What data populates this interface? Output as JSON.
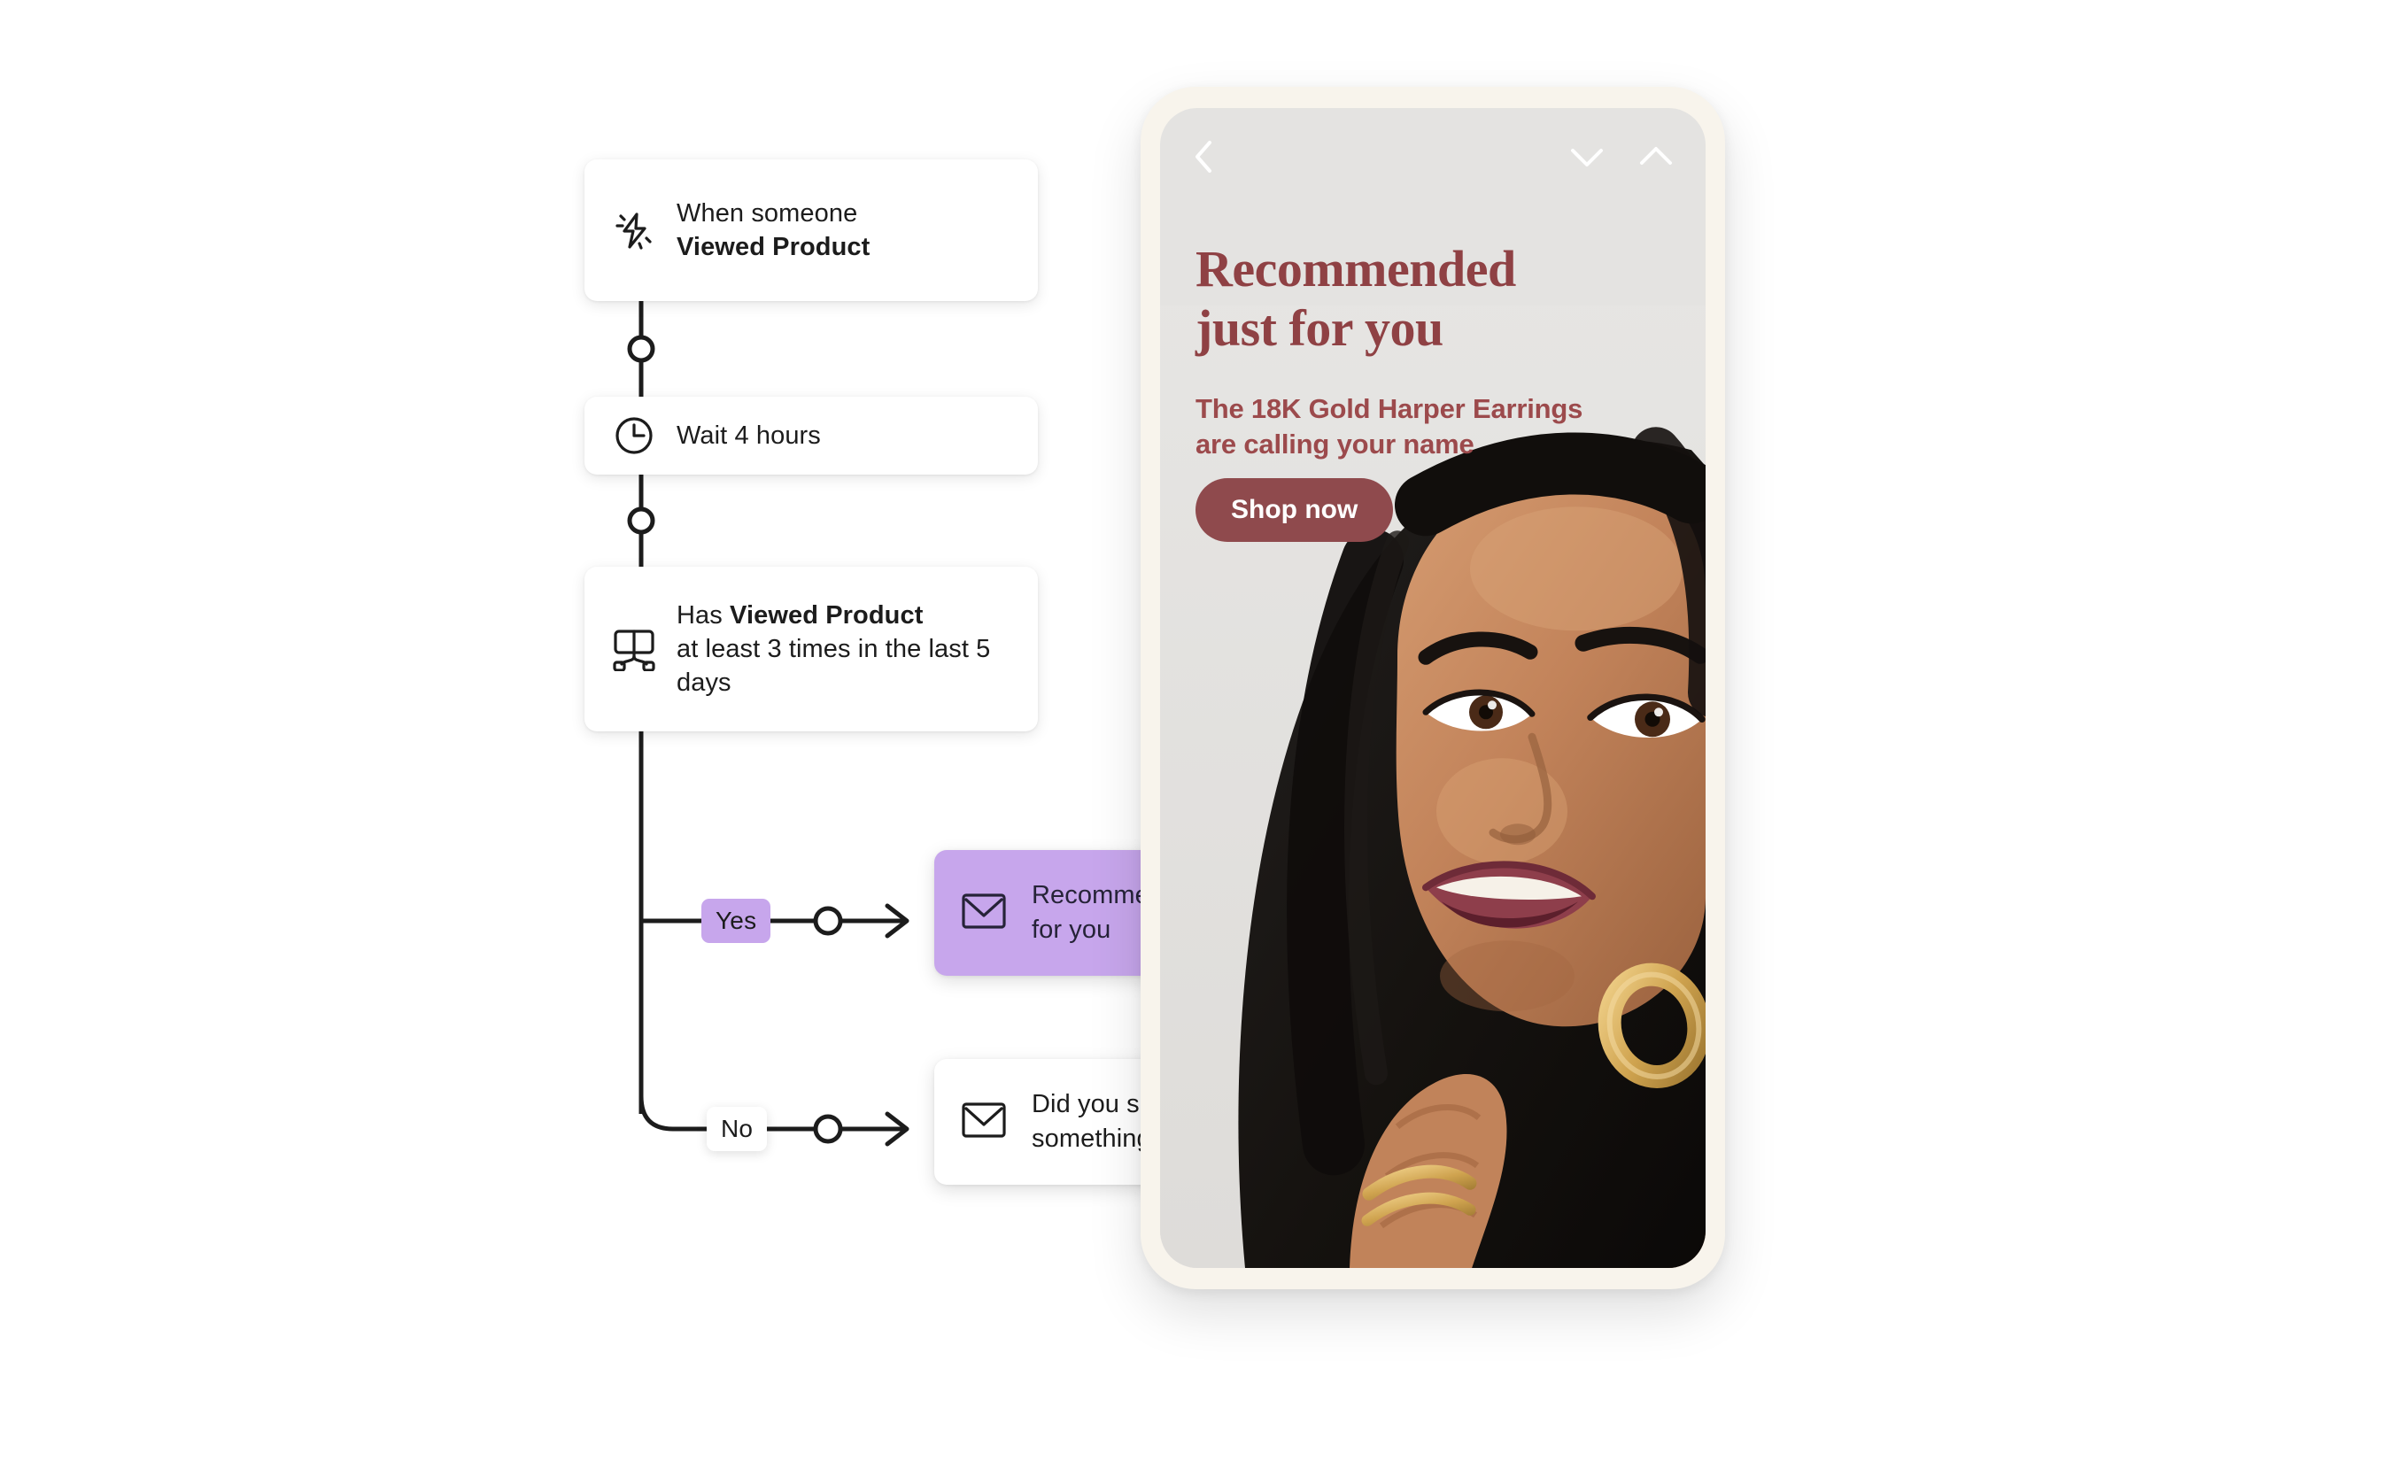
{
  "flow": {
    "nodes": [
      {
        "id": "trigger",
        "icon": "lightning-bolt-icon",
        "line1": "When someone",
        "line2": "Viewed Product"
      },
      {
        "id": "wait",
        "icon": "clock-icon",
        "label": "Wait 4 hours"
      },
      {
        "id": "condition",
        "icon": "split-branch-icon",
        "prefix": "Has ",
        "strong": "Viewed Product",
        "rest": "at least 3 times in the last 5 days"
      }
    ],
    "branches": [
      {
        "id": "yes",
        "label": "Yes",
        "color": "#c7a6ec"
      },
      {
        "id": "no",
        "label": "No",
        "color": "#ffffff"
      }
    ],
    "messages": [
      {
        "id": "yes-message",
        "icon": "envelope-icon",
        "line1": "Recommended just",
        "line2": "for you",
        "color": "#c7a6ec"
      },
      {
        "id": "no-message",
        "icon": "envelope-icon",
        "line1": "Did you see",
        "line2": "something you liked?",
        "color": "#ffffff"
      }
    ]
  },
  "phone": {
    "nav": {
      "back_icon": "chevron-left-icon",
      "down_icon": "chevron-down-icon",
      "up_icon": "chevron-up-icon"
    },
    "email": {
      "headline_line1": "Recommended",
      "headline_line2": "just for you",
      "subhead_line1": "The 18K Gold Harper Earrings",
      "subhead_line2": "are calling your name",
      "cta_label": "Shop now",
      "headline_color": "#8f4144",
      "cta_color": "#8f4a4d",
      "screen_color": "#e4e3e1",
      "frame_color": "#f8f4ec",
      "photo_alt": "Smiling woman with dark hair wearing gold hoop earrings and gold rings"
    }
  }
}
